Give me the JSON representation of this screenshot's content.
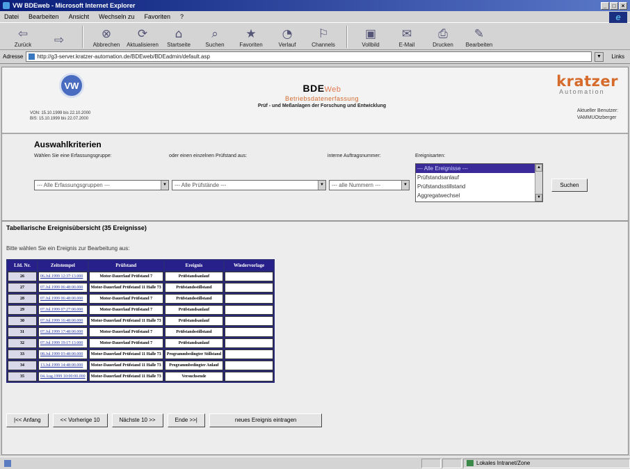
{
  "window": {
    "title": "VW BDEweb - Microsoft Internet Explorer",
    "controls": [
      "_",
      "□",
      "×"
    ]
  },
  "menubar": [
    "Datei",
    "Bearbeiten",
    "Ansicht",
    "Wechseln zu",
    "Favoriten",
    "?"
  ],
  "toolbar": [
    {
      "label": "Zurück",
      "icon": "back-icon",
      "glyph": "⇦"
    },
    {
      "label": "",
      "icon": "forward-icon",
      "glyph": "⇨"
    },
    {
      "label": "Abbrechen",
      "icon": "stop-icon",
      "glyph": "⊗"
    },
    {
      "label": "Aktualisieren",
      "icon": "refresh-icon",
      "glyph": "⟳"
    },
    {
      "label": "Startseite",
      "icon": "home-icon",
      "glyph": "⌂"
    },
    {
      "label": "Suchen",
      "icon": "search-icon",
      "glyph": "⌕"
    },
    {
      "label": "Favoriten",
      "icon": "favorites-icon",
      "glyph": "★"
    },
    {
      "label": "Verlauf",
      "icon": "history-icon",
      "glyph": "◔"
    },
    {
      "label": "Channels",
      "icon": "channels-icon",
      "glyph": "⚐"
    },
    {
      "label": "Vollbild",
      "icon": "fullscreen-icon",
      "glyph": "▣"
    },
    {
      "label": "E-Mail",
      "icon": "mail-icon",
      "glyph": "✉"
    },
    {
      "label": "Drucken",
      "icon": "print-icon",
      "glyph": "⎙"
    },
    {
      "label": "Bearbeiten",
      "icon": "edit-icon",
      "glyph": "✎"
    }
  ],
  "address": {
    "label": "Adresse",
    "url": "http://g3-server.kratzer-automation.de/BDEweb/BDEadmin/default.asp",
    "links_label": "Links"
  },
  "header": {
    "vw_mark": "VW",
    "dates": [
      "VON: 15.10.1999 bis 22.10.2000",
      "BIS: 15.10.1999 bis 22.07.2000"
    ],
    "bde": "BDE",
    "web": "Web",
    "subtitle": "Betriebsdatenerfassung",
    "description": "Prüf - und Meßanlagen der Forschung und Entwicklung",
    "brand_name": "kratzer",
    "brand_sub": "Automation",
    "user_label": "Aktueller Benutzer:",
    "user_value": "VAMMUOtzberger"
  },
  "criteria": {
    "title": "Auswahlkriterien",
    "labels": {
      "group": "Wählen Sie eine Erfassungsgruppe:",
      "stand": "oder einen einzelnen Prüfstand aus:",
      "order": "interne Auftragsnummer:",
      "events": "Ereignisarten:"
    },
    "selects": {
      "group": "--- Alle Erfassungsgruppen ---",
      "stand": "--- Alle Prüfstände ---",
      "order": "--- alle Nummern ---"
    },
    "event_options": [
      "--- Alle Ereignisse ---",
      "Prüfstandsanlauf",
      "Prüfstandsstillstand",
      "Aggregatwechsel"
    ],
    "search_button": "Suchen"
  },
  "results": {
    "title": "Tabellarische Ereignisübersicht (35 Ereignisse)",
    "hint": "Bitte wählen Sie ein Ereignis zur Bearbeitung aus:",
    "columns": [
      "Lfd. Nr.",
      "Zeitstempel",
      "Prüfstand",
      "Ereignis",
      "Wiedervorlage"
    ],
    "rows": [
      {
        "nr": "26",
        "time": "06.Jul.1999 12:37:13.000",
        "stand": "Motor-Dauerlauf Prüfstand 7",
        "event": "Prüfstandsanlauf",
        "resub": ""
      },
      {
        "nr": "27",
        "time": "07.Jul.1999 06:48:00.000",
        "stand": "Motor-Dauerlauf Prüfstand 11 Halle 73",
        "event": "Prüfstandsstillstand",
        "resub": ""
      },
      {
        "nr": "28",
        "time": "07.Jul.1999 06:48:00.000",
        "stand": "Motor-Dauerlauf Prüfstand 7",
        "event": "Prüfstandsstillstand",
        "resub": ""
      },
      {
        "nr": "29",
        "time": "07.Jul.1999 07:27:00.000",
        "stand": "Motor-Dauerlauf Prüfstand 7",
        "event": "Prüfstandsanlauf",
        "resub": ""
      },
      {
        "nr": "30",
        "time": "07.Jul.1999 16:48:00.000",
        "stand": "Motor-Dauerlauf Prüfstand 11 Halle 73",
        "event": "Prüfstandsanlauf",
        "resub": ""
      },
      {
        "nr": "31",
        "time": "07.Jul.1999 17:48:00.000",
        "stand": "Motor-Dauerlauf Prüfstand 7",
        "event": "Prüfstandsstillstand",
        "resub": ""
      },
      {
        "nr": "32",
        "time": "07.Jul.1999 19:17:13.000",
        "stand": "Motor-Dauerlauf Prüfstand 7",
        "event": "Prüfstandsanlauf",
        "resub": ""
      },
      {
        "nr": "33",
        "time": "08.Jul.1999 03:48:00.000",
        "stand": "Motor-Dauerlauf Prüfstand 11 Halle 73",
        "event": "Programmbedingter Stillstand",
        "resub": ""
      },
      {
        "nr": "34",
        "time": "13.Jul.1999 14:48:00.000",
        "stand": "Motor-Dauerlauf Prüfstand 11 Halle 73",
        "event": "Programmbedingter Anlauf",
        "resub": ""
      },
      {
        "nr": "35",
        "time": "04.Aug.1999 10:00:00.000",
        "stand": "Motor-Dauerlauf Prüfstand 11 Halle 73",
        "event": "Versuchsende",
        "resub": ""
      }
    ]
  },
  "nav": {
    "first": "|<< Anfang",
    "prev": "<< Vorherige 10",
    "next": "Nächste 10 >>",
    "last": "Ende >>|",
    "new_event": "neues Ereignis eintragen"
  },
  "status": {
    "text": "",
    "zone": "Lokales Intranet/Zone"
  }
}
